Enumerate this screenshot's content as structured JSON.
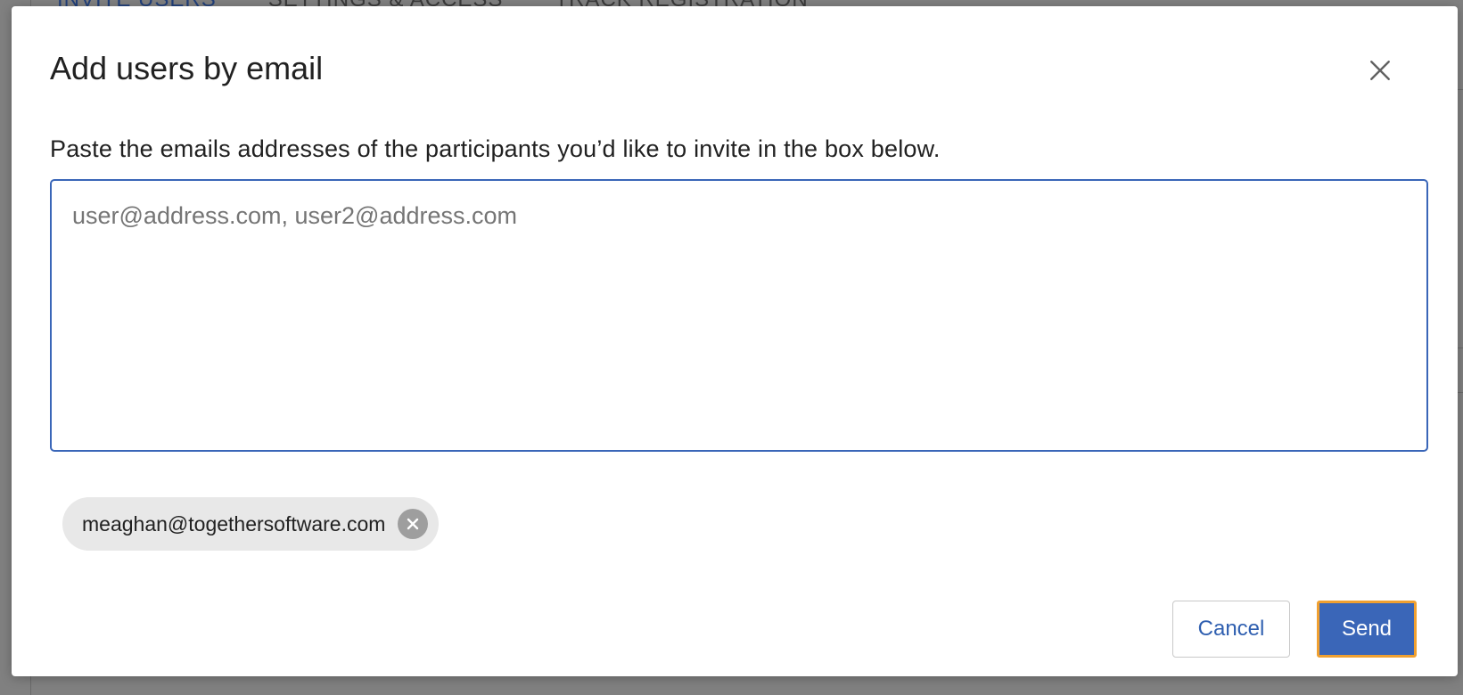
{
  "background": {
    "tabs": [
      {
        "label": "INVITE USERS",
        "active": true
      },
      {
        "label": "SETTINGS & ACCESS",
        "active": false
      },
      {
        "label": "TRACK REGISTRATION",
        "active": false
      }
    ]
  },
  "modal": {
    "title": "Add users by email",
    "close_icon": "close-icon",
    "instruction": "Paste the emails addresses of the participants you’d like to invite in the box below.",
    "email_input": {
      "value": "",
      "placeholder": "user@address.com, user2@address.com"
    },
    "chips": [
      {
        "label": "meaghan@togethersoftware.com",
        "remove_icon": "close-circle-icon"
      }
    ],
    "buttons": {
      "cancel_label": "Cancel",
      "send_label": "Send"
    }
  },
  "colors": {
    "accent": "#3a66b8",
    "focus_outline": "#f0a030",
    "overlay": "#808080",
    "chip_bg": "#e8e8e8"
  }
}
